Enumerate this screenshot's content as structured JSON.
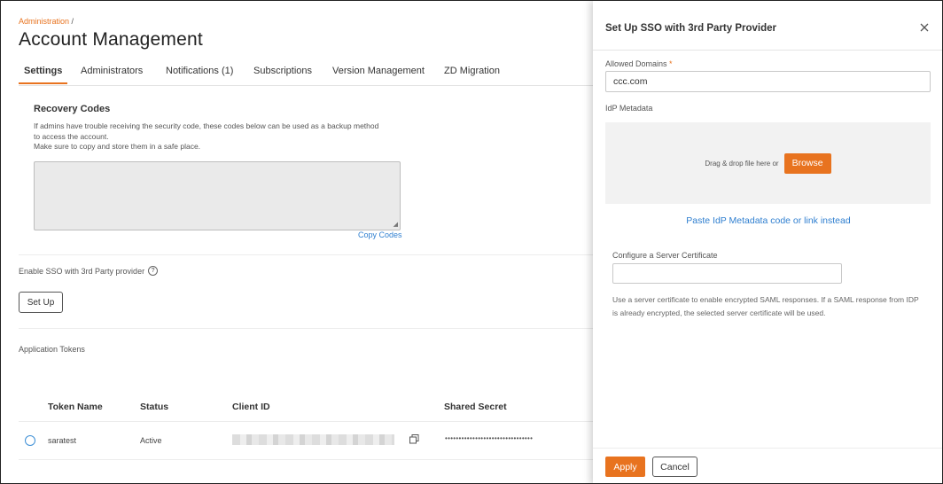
{
  "breadcrumb": {
    "parent": "Administration",
    "separator": "/"
  },
  "page": {
    "title": "Account Management"
  },
  "tabs": [
    {
      "label": "Settings",
      "active": true
    },
    {
      "label": "Administrators"
    },
    {
      "label": "Notifications (1)"
    },
    {
      "label": "Subscriptions"
    },
    {
      "label": "Version Management"
    },
    {
      "label": "ZD Migration"
    }
  ],
  "recovery": {
    "title": "Recovery Codes",
    "description_lines": [
      "If admins have trouble receiving the security code, these codes below can be used as a backup method",
      "to access the account.",
      "Make sure to copy and store them in a safe place."
    ],
    "codes_value": "",
    "copy_label": "Copy Codes"
  },
  "sso": {
    "label": "Enable SSO with 3rd Party provider",
    "help_icon": "question-circle-icon",
    "setup_label": "Set Up"
  },
  "tokens": {
    "section_label": "Application Tokens",
    "columns": [
      "Token Name",
      "Status",
      "Client ID",
      "Shared Secret"
    ],
    "rows": [
      {
        "name": "saratest",
        "status": "Active",
        "client_id": "",
        "shared_secret": "••••••••••••••••••••••••••••••••"
      }
    ]
  },
  "drawer": {
    "title": "Set Up SSO with 3rd Party Provider",
    "allowed_domains_label": "Allowed Domains",
    "required_mark": "*",
    "allowed_domains_value": "ccc.com",
    "idp_metadata_label": "IdP Metadata",
    "dropzone_text": "Drag & drop file here or",
    "browse_label": "Browse",
    "paste_link": "Paste IdP Metadata code or link instead",
    "cert_label": "Configure a Server Certificate",
    "cert_value": "",
    "cert_help": "Use a server certificate to enable encrypted SAML responses.  If a SAML response from IDP is already encrypted, the selected server certificate will be used.",
    "apply_label": "Apply",
    "cancel_label": "Cancel"
  },
  "colors": {
    "accent": "#e8731f",
    "link": "#2f7fd0"
  }
}
